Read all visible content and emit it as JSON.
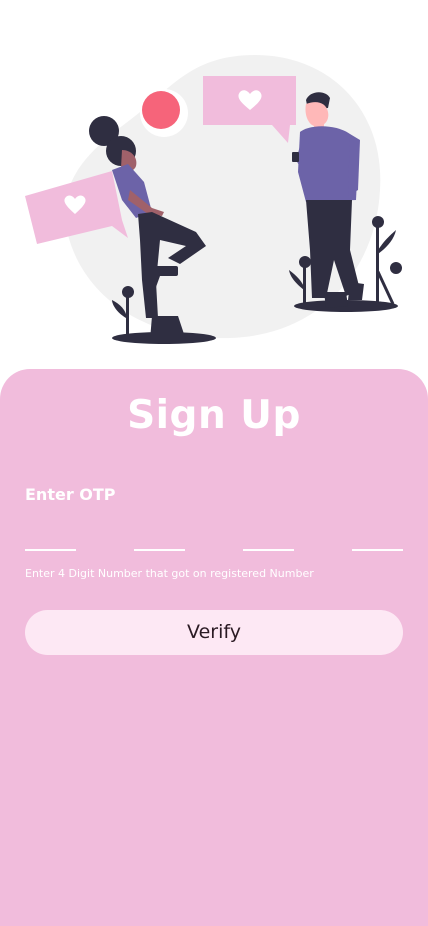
{
  "hero": {
    "illustration_icon": "couple-chatting-illustration",
    "bubble_icon": "heart-icon"
  },
  "signup": {
    "title": "Sign Up",
    "otp_label": "Enter OTP",
    "otp_digits": [
      "",
      "",
      "",
      ""
    ],
    "hint": "Enter 4 Digit Number that got on registered Number",
    "verify_label": "Verify"
  },
  "colors": {
    "card": "#f1bcdc",
    "button": "#fde8f4",
    "accent_dot": "#f6647a",
    "bubble": "#f1bcdc",
    "figure_dark": "#2f2e41",
    "shirt": "#6c63a8"
  }
}
